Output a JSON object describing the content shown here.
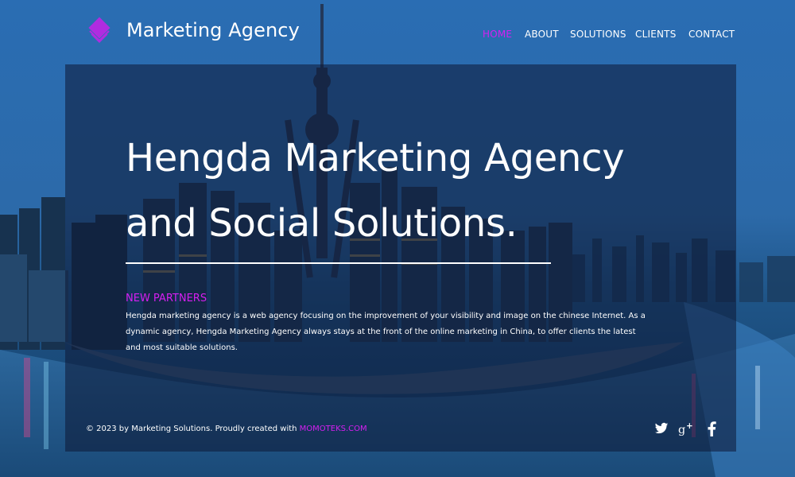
{
  "brand": {
    "name": "Marketing Agency",
    "logo_icon": "layered-diamond-logo-icon",
    "accent_color": "#d51ff0"
  },
  "nav": {
    "items": [
      {
        "label": "HOME",
        "active": true
      },
      {
        "label": "ABOUT",
        "active": false
      },
      {
        "label": "SOLUTIONS",
        "active": false
      },
      {
        "label": "CLIENTS",
        "active": false
      },
      {
        "label": "CONTACT",
        "active": false
      }
    ]
  },
  "hero": {
    "headline_line1": "Hengda Marketing Agency",
    "headline_line2": "and Social Solutions.",
    "subheading": "NEW PARTNERS",
    "body": "Hengda marketing agency is a web agency focusing on the improvement of your visibility and image on the chinese Internet. As a dynamic agency, Hengda Marketing Agency always stays at the front of the online marketing in China, to offer clients the latest and most suitable solutions."
  },
  "footer": {
    "copyright_text": "© 2023 by Marketing Solutions. Proudly created with ",
    "link_text": "MOMOTEKS.COM",
    "social_icons": [
      "twitter-icon",
      "google-plus-icon",
      "facebook-icon"
    ]
  }
}
